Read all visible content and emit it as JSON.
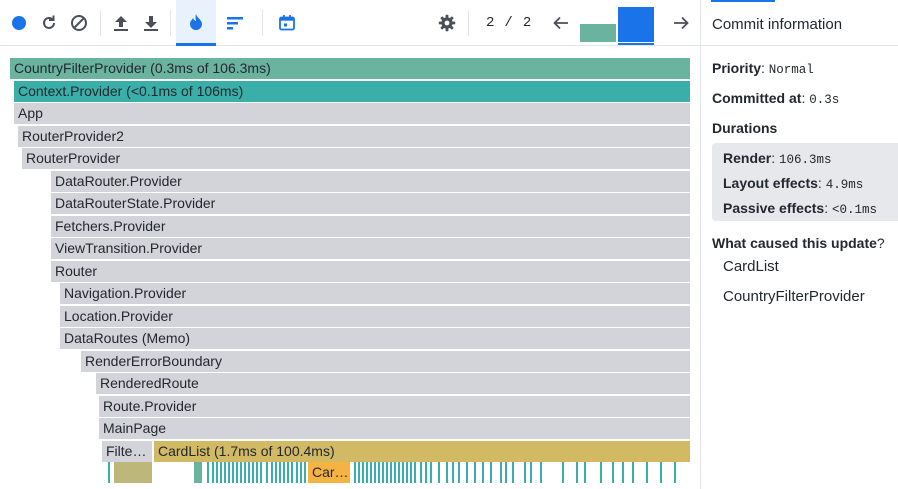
{
  "toolbar": {
    "icons": [
      "record-icon",
      "reload-icon",
      "clear-icon",
      "upload-icon",
      "download-icon",
      "flamegraph-icon",
      "ranked-icon",
      "timeline-icon",
      "settings-icon",
      "prev-arrow-icon",
      "next-arrow-icon"
    ],
    "commit_index": "2",
    "commit_separator": "/",
    "commit_total": "2",
    "colors": {
      "record": "#1a73e8",
      "accent": "#1a73e8",
      "snapshot1": "#6ab39e",
      "snapshot2": "#1a73e8"
    }
  },
  "panel": {
    "title": "Commit information",
    "priority_label": "Priority",
    "priority_value": "Normal",
    "committed_label": "Committed at",
    "committed_value": "0.3s",
    "durations_label": "Durations",
    "render_label": "Render",
    "render_value": "106.3ms",
    "layout_label": "Layout effects",
    "layout_value": "4.9ms",
    "passive_label": "Passive effects",
    "passive_value": "<0.1ms",
    "cause_label": "What caused this update",
    "causes": [
      "CardList",
      "CountryFilterProvider"
    ]
  },
  "flamegraph": {
    "rows": [
      "CountryFilterProvider (0.3ms of 106.3ms)",
      "Context.Provider (<0.1ms of 106ms)",
      "App",
      "RouterProvider2",
      "RouterProvider",
      "DataRouter.Provider",
      "DataRouterState.Provider",
      "Fetchers.Provider",
      "ViewTransition.Provider",
      "Router",
      "Navigation.Provider",
      "Location.Provider",
      "DataRoutes (Memo)",
      "RenderErrorBoundary",
      "RenderedRoute",
      "Route.Provider",
      "MainPage"
    ],
    "filter_label": "Filte…",
    "cardlist_label": "CardList (1.7ms of 100.4ms)",
    "card_label": "Car…"
  }
}
